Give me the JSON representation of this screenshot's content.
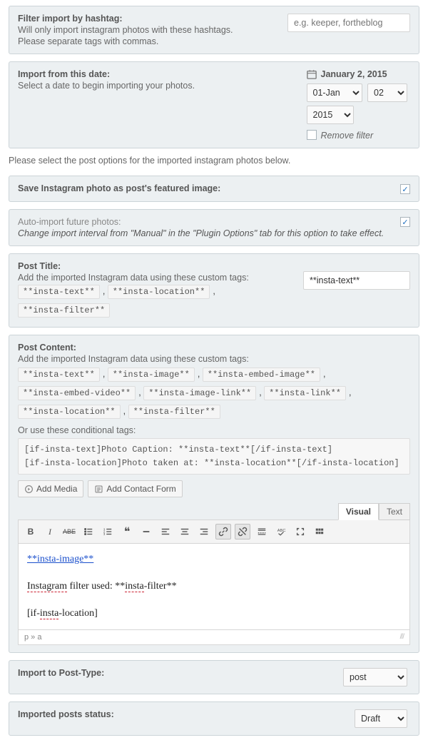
{
  "filterHashtag": {
    "title": "Filter import by hashtag:",
    "hint1": "Will only import instagram photos with these hashtags.",
    "hint2": "Please separate tags with commas.",
    "placeholder": "e.g. keeper, fortheblog"
  },
  "importDate": {
    "title": "Import from this date:",
    "hint": "Select a date to begin importing your photos.",
    "dateLabel": "January 2, 2015",
    "month": "01-Jan",
    "day": "02",
    "year": "2015",
    "removeFilter": "Remove filter"
  },
  "note": "Please select the post options for the imported instagram photos below.",
  "featured": {
    "title": "Save Instagram photo as post's featured image:",
    "checked": true
  },
  "autoImport": {
    "title": "Auto-import future photos:",
    "hint": "Change import interval from \"Manual\" in the \"Plugin Options\" tab for this option to take effect.",
    "checked": true
  },
  "postTitle": {
    "title": "Post Title:",
    "hint": "Add the imported Instagram data using these custom tags:",
    "tags": [
      "**insta-text**",
      "**insta-location**",
      "**insta-filter**"
    ],
    "value": "**insta-text**"
  },
  "postContent": {
    "title": "Post Content:",
    "hint": "Add the imported Instagram data using these custom tags:",
    "tags": [
      "**insta-text**",
      "**insta-image**",
      "**insta-embed-image**",
      "**insta-embed-video**",
      "**insta-image-link**",
      "**insta-link**",
      "**insta-location**",
      "**insta-filter**"
    ],
    "condHint": "Or use these conditional tags:",
    "cond1": "[if-insta-text]Photo Caption: **insta-text**[/if-insta-text]",
    "cond2": "[if-insta-location]Photo taken at: **insta-location**[/if-insta-location]",
    "addMedia": "Add Media",
    "addContact": "Add Contact Form",
    "tabVisual": "Visual",
    "tabText": "Text",
    "bodyLink": "**insta-image**",
    "bodyLine2a": "Instagram",
    "bodyLine2b": " filter used: **",
    "bodyLine2c": "insta",
    "bodyLine2d": "-filter**",
    "bodyLine3a": "[if-",
    "bodyLine3b": "insta",
    "bodyLine3c": "-location]",
    "status": "p » a"
  },
  "postType": {
    "title": "Import to Post-Type:",
    "value": "post"
  },
  "postStatus": {
    "title": "Imported posts status:",
    "value": "Draft"
  }
}
